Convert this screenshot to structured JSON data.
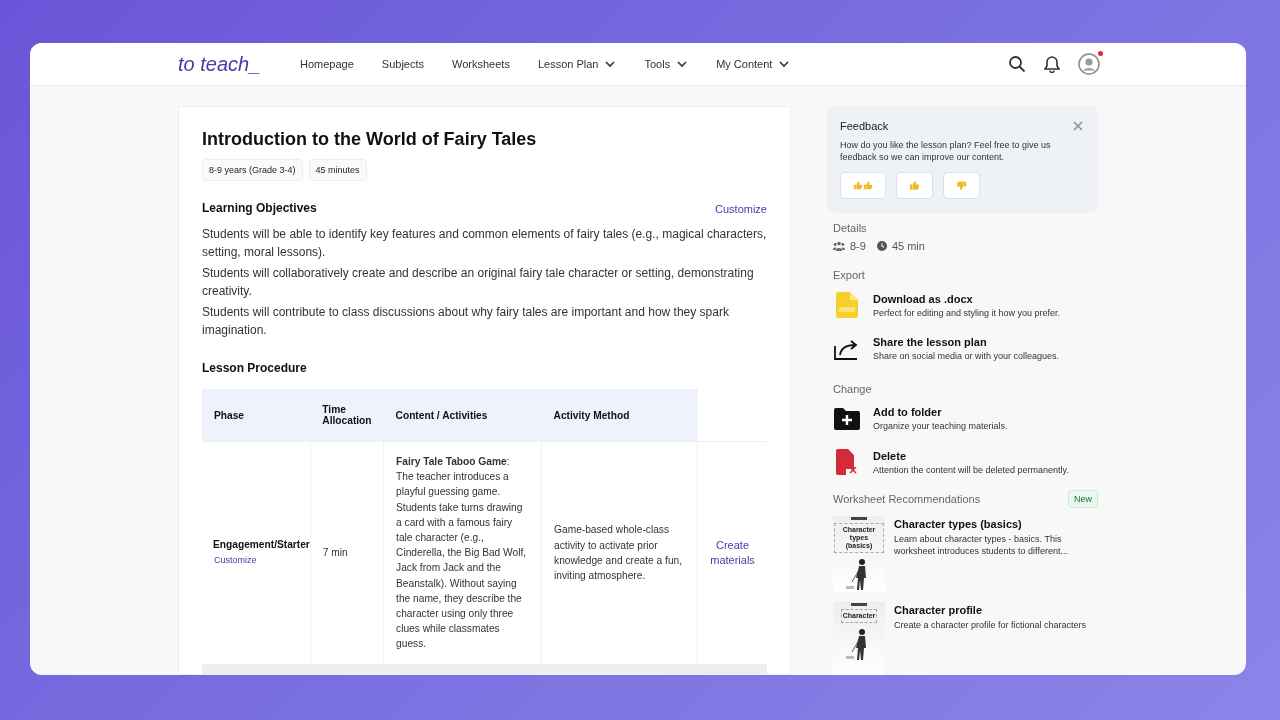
{
  "brand": "to teach_",
  "nav": [
    {
      "label": "Homepage",
      "dropdown": false
    },
    {
      "label": "Subjects",
      "dropdown": false
    },
    {
      "label": "Worksheets",
      "dropdown": false
    },
    {
      "label": "Lesson Plan",
      "dropdown": true
    },
    {
      "label": "Tools",
      "dropdown": true
    },
    {
      "label": "My Content",
      "dropdown": true
    }
  ],
  "account": {
    "has_notification": true
  },
  "lesson": {
    "title": "Introduction to the World of Fairy Tales",
    "tags": [
      "8-9 years (Grade 3-4)",
      "45 minutes"
    ],
    "objectives_heading": "Learning Objectives",
    "customize": "Customize",
    "objectives": [
      "Students will be able to identify key features and common elements of fairy tales (e.g., magical characters, setting, moral lessons).",
      "Students will collaboratively create and describe an original fairy tale character or setting, demonstrating creativity.",
      "Students will contribute to class discussions about why fairy tales are important and how they spark imagination."
    ],
    "procedure_heading": "Lesson Procedure",
    "table": {
      "columns": [
        "Phase",
        "Time Allocation",
        "Content / Activities",
        "Activity Method"
      ],
      "rows": [
        {
          "phase": "Engagement/Starter",
          "phase_link": "Customize",
          "time": "7 min",
          "content": "**Fairy Tale Taboo Game**: The teacher introduces a playful guessing game. Students take turns drawing a card with a famous fairy tale character (e.g., Cinderella, the Big Bad Wolf, Jack from Jack and the Beanstalk). Without saying the name, they describe the character using only three clues while classmates guess.",
          "method": "Game-based whole-class activity to activate prior knowledge and create a fun, inviting atmosphere.",
          "action": "Create materials"
        }
      ]
    }
  },
  "sidebar": {
    "feedback": {
      "title": "Feedback",
      "text": "How do you like the lesson plan? Feel free to give us feedback so we can improve our content.",
      "reactions": [
        {
          "kind": "double-up"
        },
        {
          "kind": "up"
        },
        {
          "kind": "down"
        }
      ]
    },
    "details": {
      "heading": "Details",
      "age": "8-9",
      "duration": "45 min"
    },
    "sections": [
      {
        "heading": "Export",
        "actions": [
          {
            "kind": "doc",
            "title": "Download as .docx",
            "text": "Perfect for editing and styling it how you prefer."
          },
          {
            "kind": "share",
            "title": "Share the lesson plan",
            "text": "Share on social media or with your colleagues."
          }
        ]
      },
      {
        "heading": "Change",
        "actions": [
          {
            "kind": "folder",
            "title": "Add to folder",
            "text": "Organize your teaching materials."
          },
          {
            "kind": "delete",
            "title": "Delete",
            "text": "Attention the content will be deleted permanently."
          }
        ]
      }
    ],
    "recommendations": {
      "heading": "Worksheet Recommendations",
      "badge": "New",
      "items": [
        {
          "thumb_title": "Character types (basics)",
          "title": "Character types (basics)",
          "text": "Learn about character types - basics. This worksheet introduces students to different..."
        },
        {
          "thumb_title": "Character",
          "title": "Character profile",
          "text": "Create a character profile for fictional characters"
        }
      ]
    }
  }
}
